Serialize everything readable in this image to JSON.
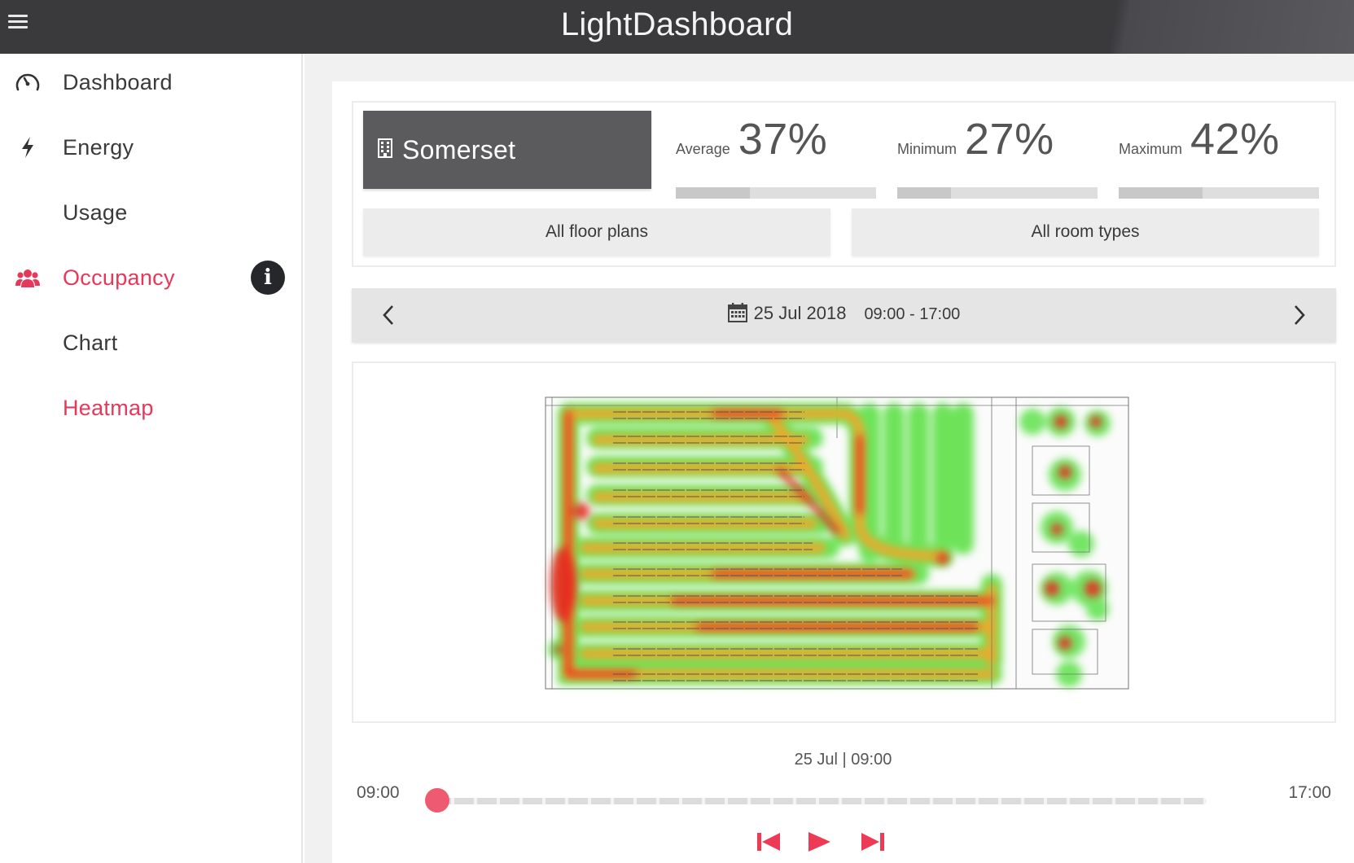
{
  "header": {
    "title": "LightDashboard",
    "menu_icon": "hamburger-menu-icon"
  },
  "sidebar": {
    "items": [
      {
        "label": "Dashboard",
        "icon": "speedometer-icon",
        "active": false
      },
      {
        "label": "Energy",
        "icon": "lightning-bolt-icon",
        "active": false
      },
      {
        "label": "Usage",
        "icon": "",
        "active": false
      },
      {
        "label": "Occupancy",
        "icon": "people-group-icon",
        "active": true
      },
      {
        "label": "Chart",
        "icon": "",
        "active": false
      },
      {
        "label": "Heatmap",
        "icon": "",
        "active": true
      }
    ],
    "info_glyph": "i"
  },
  "site": {
    "name": "Somerset",
    "icon": "building-icon"
  },
  "stats": {
    "average": {
      "label": "Average",
      "value": "37%",
      "fraction": 0.37
    },
    "minimum": {
      "label": "Minimum",
      "value": "27%",
      "fraction": 0.27
    },
    "maximum": {
      "label": "Maximum",
      "value": "42%",
      "fraction": 0.42
    }
  },
  "filters": {
    "floor_plans": "All floor plans",
    "room_types": "All room types"
  },
  "date_nav": {
    "date": "25 Jul 2018",
    "time_range": "09:00 - 17:00",
    "calendar_icon": "calendar-icon"
  },
  "timeline": {
    "current": "25 Jul | 09:00",
    "start": "09:00",
    "end": "17:00",
    "progress": 0.0
  },
  "colors": {
    "accent": "#e8385a",
    "header": "#3a3a3d",
    "site_button": "#5b5b5e",
    "badge": "#26272b"
  }
}
